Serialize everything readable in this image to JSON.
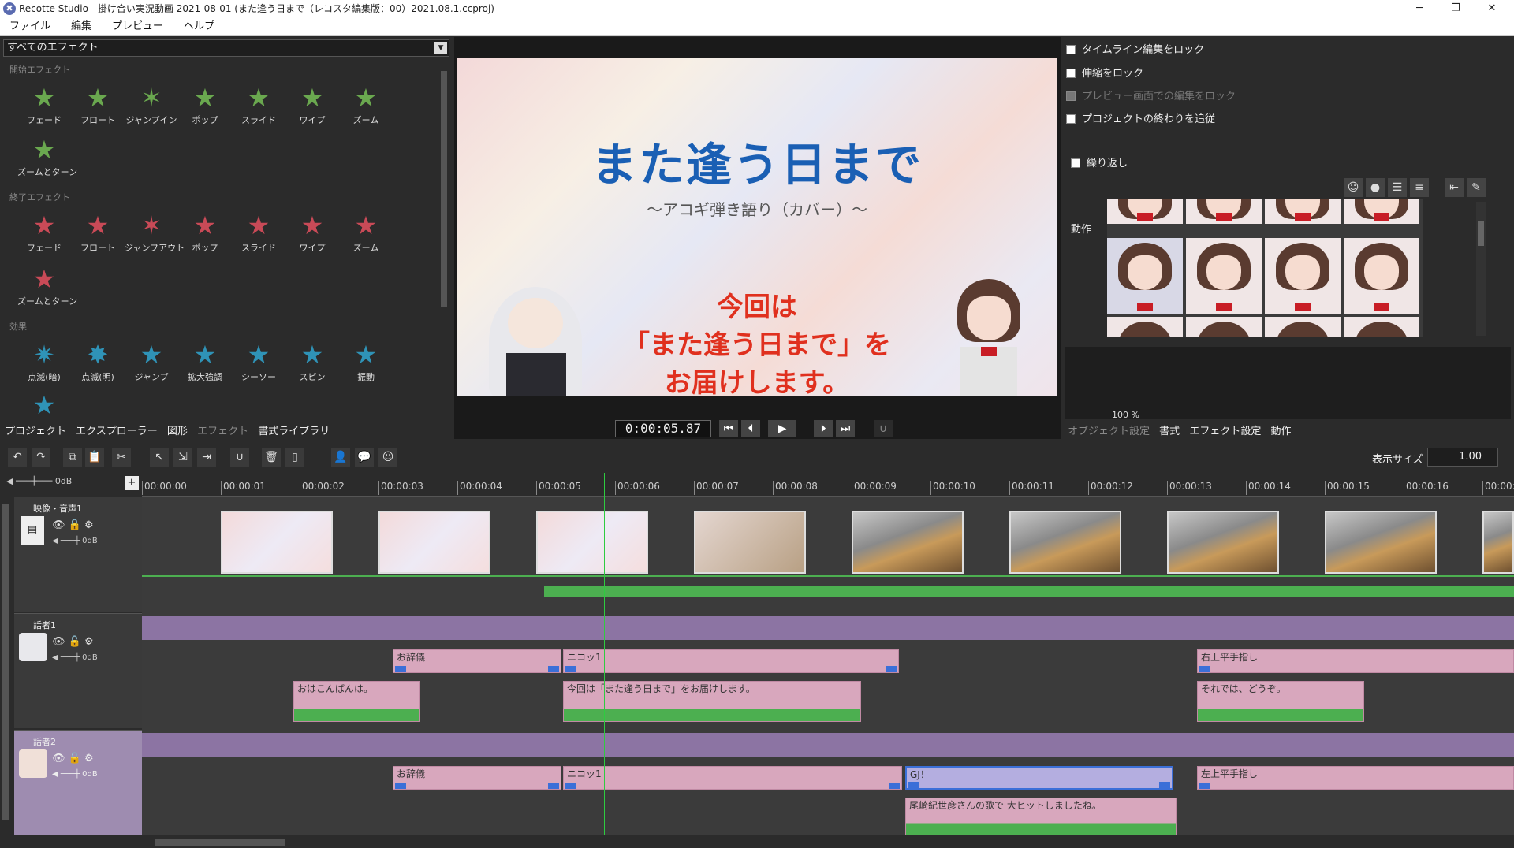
{
  "window": {
    "title": "Recotte Studio - 掛け合い実況動画 2021-08-01 (また逢う日まで（レコスタ編集版：00）2021.08.1.ccproj)",
    "min": "─",
    "max": "❐",
    "close": "✕"
  },
  "menu": [
    "ファイル",
    "編集",
    "プレビュー",
    "ヘルプ"
  ],
  "effects": {
    "select_value": "すべてのエフェクト",
    "sections": {
      "start": {
        "label": "開始エフェクト",
        "items": [
          "フェード",
          "フロート",
          "ジャンプイン",
          "ポップ",
          "スライド",
          "ワイプ",
          "ズーム",
          "ズームとターン"
        ]
      },
      "end": {
        "label": "終了エフェクト",
        "items": [
          "フェード",
          "フロート",
          "ジャンプアウト",
          "ポップ",
          "スライド",
          "ワイプ",
          "ズーム",
          "ズームとターン"
        ]
      },
      "effect": {
        "label": "効果",
        "items": [
          "点滅(暗)",
          "点滅(明)",
          "ジャンプ",
          "拡大強調",
          "シーソー",
          "スピン",
          "振動"
        ]
      }
    },
    "tabs": [
      "プロジェクト",
      "エクスプローラー",
      "図形",
      "エフェクト",
      "書式ライブラリ"
    ]
  },
  "preview": {
    "title": "また逢う日まで",
    "subtitle": "～アコギ弾き語り（カバー）～",
    "line1": "今回は",
    "line2": "「また逢う日まで」を",
    "line3": "お届けします。",
    "timecode": "0:00:05.87"
  },
  "right_panel": {
    "checkboxes": [
      {
        "label": "タイムライン編集をロック",
        "enabled": true
      },
      {
        "label": "伸縮をロック",
        "enabled": true
      },
      {
        "label": "プレビュー画面での編集をロック",
        "enabled": false
      },
      {
        "label": "プロジェクトの終わりを追従",
        "enabled": true
      }
    ],
    "repeat_label": "繰り返し",
    "motion_label": "動作",
    "zoom": "100 %",
    "tabs": [
      "オブジェクト設定",
      "書式",
      "エフェクト設定",
      "動作"
    ]
  },
  "timeline": {
    "display_size_label": "表示サイズ",
    "display_size_value": "1.00",
    "master_db": "0dB",
    "ticks": [
      "00:00:00",
      "00:00:01",
      "00:00:02",
      "00:00:03",
      "00:00:04",
      "00:00:05",
      "00:00:06",
      "00:00:07",
      "00:00:08",
      "00:00:09",
      "00:00:10",
      "00:00:11",
      "00:00:12",
      "00:00:13",
      "00:00:14",
      "00:00:15",
      "00:00:16",
      "00:00:1"
    ],
    "tracks": {
      "video": {
        "name": "映像・音声1",
        "db": "0dB"
      },
      "speaker1": {
        "name": "話者1",
        "db": "0dB",
        "motions": [
          "お辞儀",
          "ニコッ1",
          "右上平手指し"
        ],
        "lines": [
          "おはこんばんは。",
          "今回は「また逢う日まで」をお届けします。",
          "それでは、どうぞ。"
        ]
      },
      "speaker2": {
        "name": "話者2",
        "db": "0dB",
        "motions": [
          "お辞儀",
          "ニコッ1",
          "GJ！",
          "左上平手指し"
        ],
        "lines": [
          "尾崎紀世彦さんの歌で 大ヒットしましたね。"
        ]
      }
    }
  }
}
